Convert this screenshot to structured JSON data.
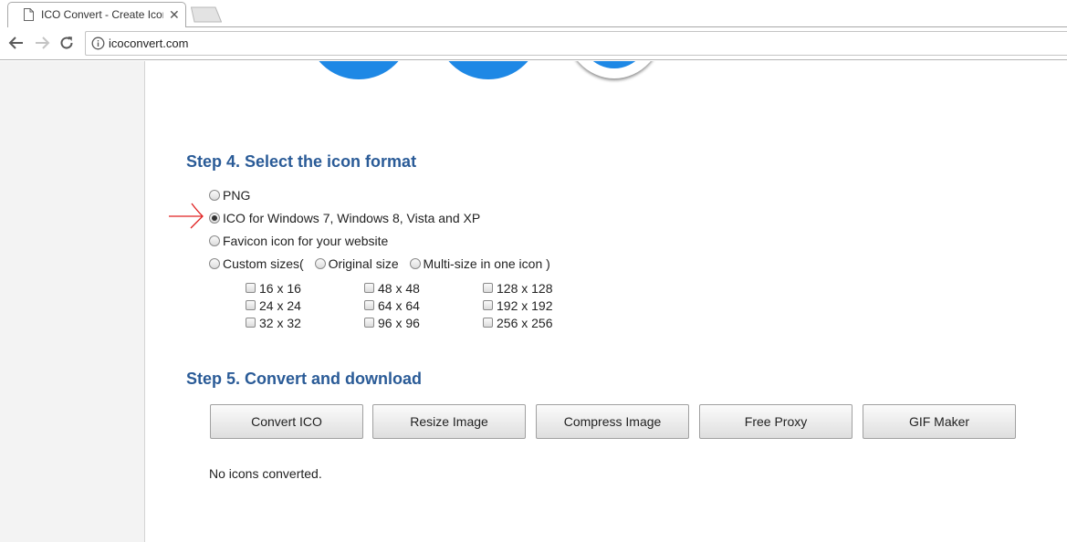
{
  "browser": {
    "tab_title": "ICO Convert - Create Icons",
    "url": "icoconvert.com"
  },
  "step4": {
    "heading": "Step 4. Select the icon format",
    "options": {
      "png": "PNG",
      "ico": "ICO for Windows 7, Windows 8, Vista and XP",
      "favicon": "Favicon icon for your website",
      "custom": "Custom sizes(",
      "original": "Original size",
      "multisize": "Multi-size in one icon )"
    },
    "selected": "ico",
    "sizes": [
      "16 x 16",
      "24 x 24",
      "32 x 32",
      "48 x 48",
      "64 x 64",
      "96 x 96",
      "128 x 128",
      "192 x 192",
      "256 x 256"
    ]
  },
  "step5": {
    "heading": "Step 5. Convert and download",
    "buttons": {
      "convert": "Convert ICO",
      "resize": "Resize Image",
      "compress": "Compress Image",
      "proxy": "Free Proxy",
      "gif": "GIF Maker"
    },
    "status": "No icons converted."
  },
  "colors": {
    "heading": "#2a5b97",
    "accent_blue": "#1e88e5",
    "annotation_arrow": "#e02020"
  }
}
